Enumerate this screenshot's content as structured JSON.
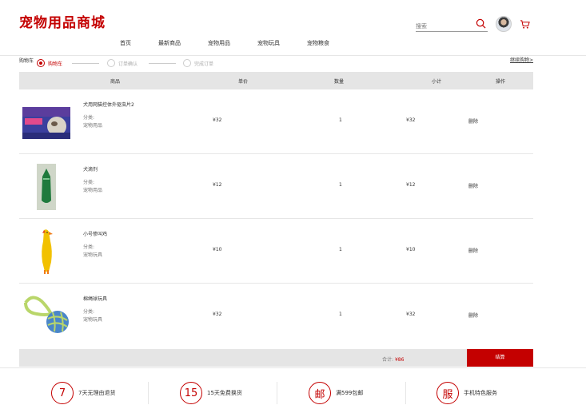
{
  "header": {
    "logo": "宠物用品商城",
    "search_placeholder": "搜索",
    "nav": [
      "首页",
      "最新商品",
      "宠物用品",
      "宠物玩具",
      "宠物粮食"
    ]
  },
  "steps": {
    "title": "购物车",
    "items": [
      "购物车",
      "订单确认",
      "完成订单"
    ],
    "continue": "继续购物>"
  },
  "table": {
    "headers": [
      "商品",
      "单价",
      "数量",
      "小计",
      "操作"
    ],
    "category_label": "分类:",
    "delete_label": "删除",
    "rows": [
      {
        "name": "犬用网猫控体外驱虫片2",
        "category": "宠物用品",
        "price": "¥32",
        "qty": "1",
        "subtotal": "¥32"
      },
      {
        "name": "犬滴剂",
        "category": "宠物用品",
        "price": "¥12",
        "qty": "1",
        "subtotal": "¥12"
      },
      {
        "name": "小号惨叫鸡",
        "category": "宠物玩具",
        "price": "¥10",
        "qty": "1",
        "subtotal": "¥10"
      },
      {
        "name": "棉绳球玩具",
        "category": "宠物玩具",
        "price": "¥32",
        "qty": "1",
        "subtotal": "¥32"
      }
    ]
  },
  "summary": {
    "total_label": "合计:",
    "total_value": "¥86",
    "checkout_label": "结算"
  },
  "footer": {
    "features": [
      {
        "icon": "7",
        "label": "7天无理由退货"
      },
      {
        "icon": "15",
        "label": "15天免费换货"
      },
      {
        "icon": "邮",
        "label": "满599包邮"
      },
      {
        "icon": "服",
        "label": "手机特色服务"
      }
    ]
  },
  "colors": {
    "brand": "#c40000",
    "header_bg": "#e5e5e5"
  }
}
